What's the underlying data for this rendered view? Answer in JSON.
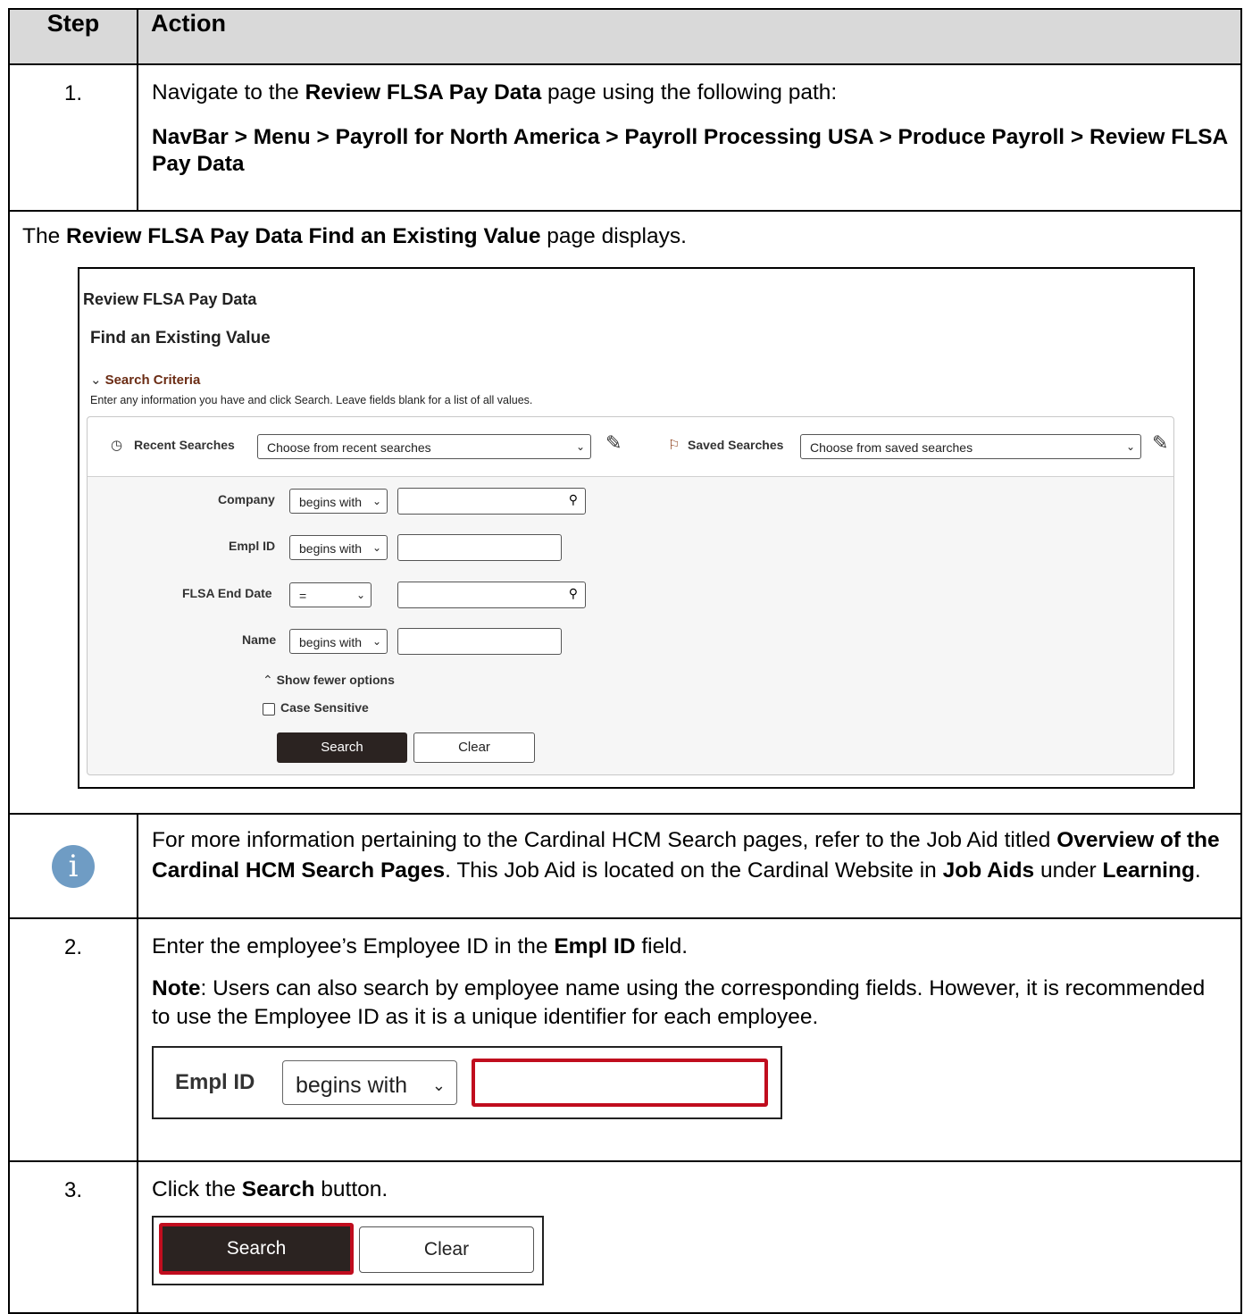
{
  "table": {
    "header": {
      "step": "Step",
      "action": "Action"
    }
  },
  "step1": {
    "num": "1.",
    "line1_pre": "Navigate to the ",
    "line1_bold": "Review FLSA Pay Data",
    "line1_post": " page using the following path:",
    "path": "NavBar > Menu > Payroll for North America > Payroll Processing USA > Produce Payroll > Review FLSA Pay Data"
  },
  "display_note": {
    "pre": "The ",
    "bold": "Review FLSA Pay Data Find an Existing Value",
    "post": " page displays."
  },
  "screenshot": {
    "title": "Review FLSA Pay Data",
    "subtitle": "Find an Existing Value",
    "criteria_label": "Search Criteria",
    "help_text": "Enter any information you have and click Search. Leave fields blank for a list of all values.",
    "recent_label": "Recent Searches",
    "recent_value": "Choose from recent searches",
    "saved_label": "Saved Searches",
    "saved_value": "Choose from saved searches",
    "fields": [
      {
        "label": "Company",
        "operator": "begins with"
      },
      {
        "label": "Empl ID",
        "operator": "begins with"
      },
      {
        "label": "FLSA End Date",
        "operator": "="
      },
      {
        "label": "Name",
        "operator": "begins with"
      }
    ],
    "show_fewer": "Show fewer options",
    "case_sensitive": "Case Sensitive",
    "search_btn": "Search",
    "clear_btn": "Clear"
  },
  "info": {
    "text1": "For more information pertaining to the Cardinal HCM Search pages, refer to the Job Aid titled ",
    "bold1": "Overview of the Cardinal HCM Search Pages",
    "text2": ". This Job Aid is located on the Cardinal Website in ",
    "bold2": "Job Aids",
    "text3": " under ",
    "bold3": "Learning",
    "text4": "."
  },
  "step2": {
    "num": "2.",
    "pre": "Enter the employee’s Employee ID in the ",
    "bold": "Empl ID",
    "post": " field.",
    "note_bold": "Note",
    "note_text": ": Users can also search by employee name using the corresponding fields. However, it is recommended to use the Employee ID as it is a unique identifier for each employee.",
    "zoom_label": "Empl ID",
    "zoom_operator": "begins with"
  },
  "step3": {
    "num": "3.",
    "pre": "Click the ",
    "bold": "Search",
    "post": " button.",
    "search_btn": "Search",
    "clear_btn": "Clear"
  },
  "colors": {
    "header_bg": "#d9d9d9",
    "info_icon": "#6f9cc4",
    "highlight": "#c00d1e",
    "search_btn_bg": "#2b2321"
  },
  "icons": {
    "info": "info-circle-icon",
    "recent": "history-icon",
    "saved": "bookmark-icon",
    "edit": "pencil-icon",
    "lookup": "magnifier-icon"
  }
}
